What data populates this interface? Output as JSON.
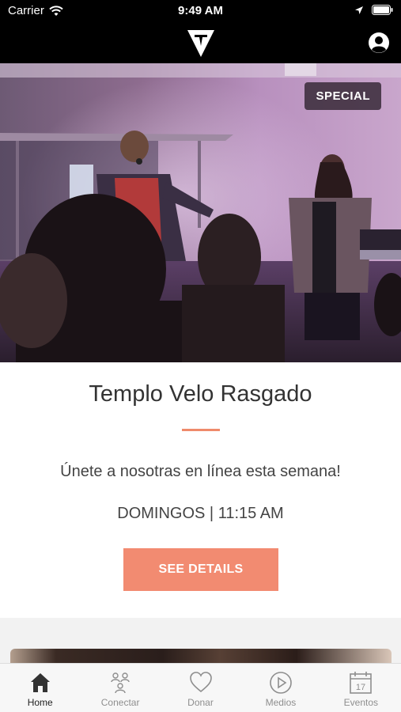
{
  "status_bar": {
    "carrier": "Carrier",
    "time": "9:49 AM"
  },
  "hero": {
    "badge": "SPECIAL"
  },
  "card": {
    "title": "Templo Velo Rasgado",
    "subtitle": "Únete a nosotras en línea esta semana!",
    "schedule": "DOMINGOS | 11:15 AM",
    "button_label": "SEE DETAILS",
    "accent_color": "#f28b71"
  },
  "tabs": [
    {
      "label": "Home",
      "icon": "home-icon",
      "active": true
    },
    {
      "label": "Conectar",
      "icon": "people-icon",
      "active": false
    },
    {
      "label": "Donar",
      "icon": "heart-icon",
      "active": false
    },
    {
      "label": "Medios",
      "icon": "play-icon",
      "active": false
    },
    {
      "label": "Eventos",
      "icon": "calendar-icon",
      "active": false
    }
  ]
}
